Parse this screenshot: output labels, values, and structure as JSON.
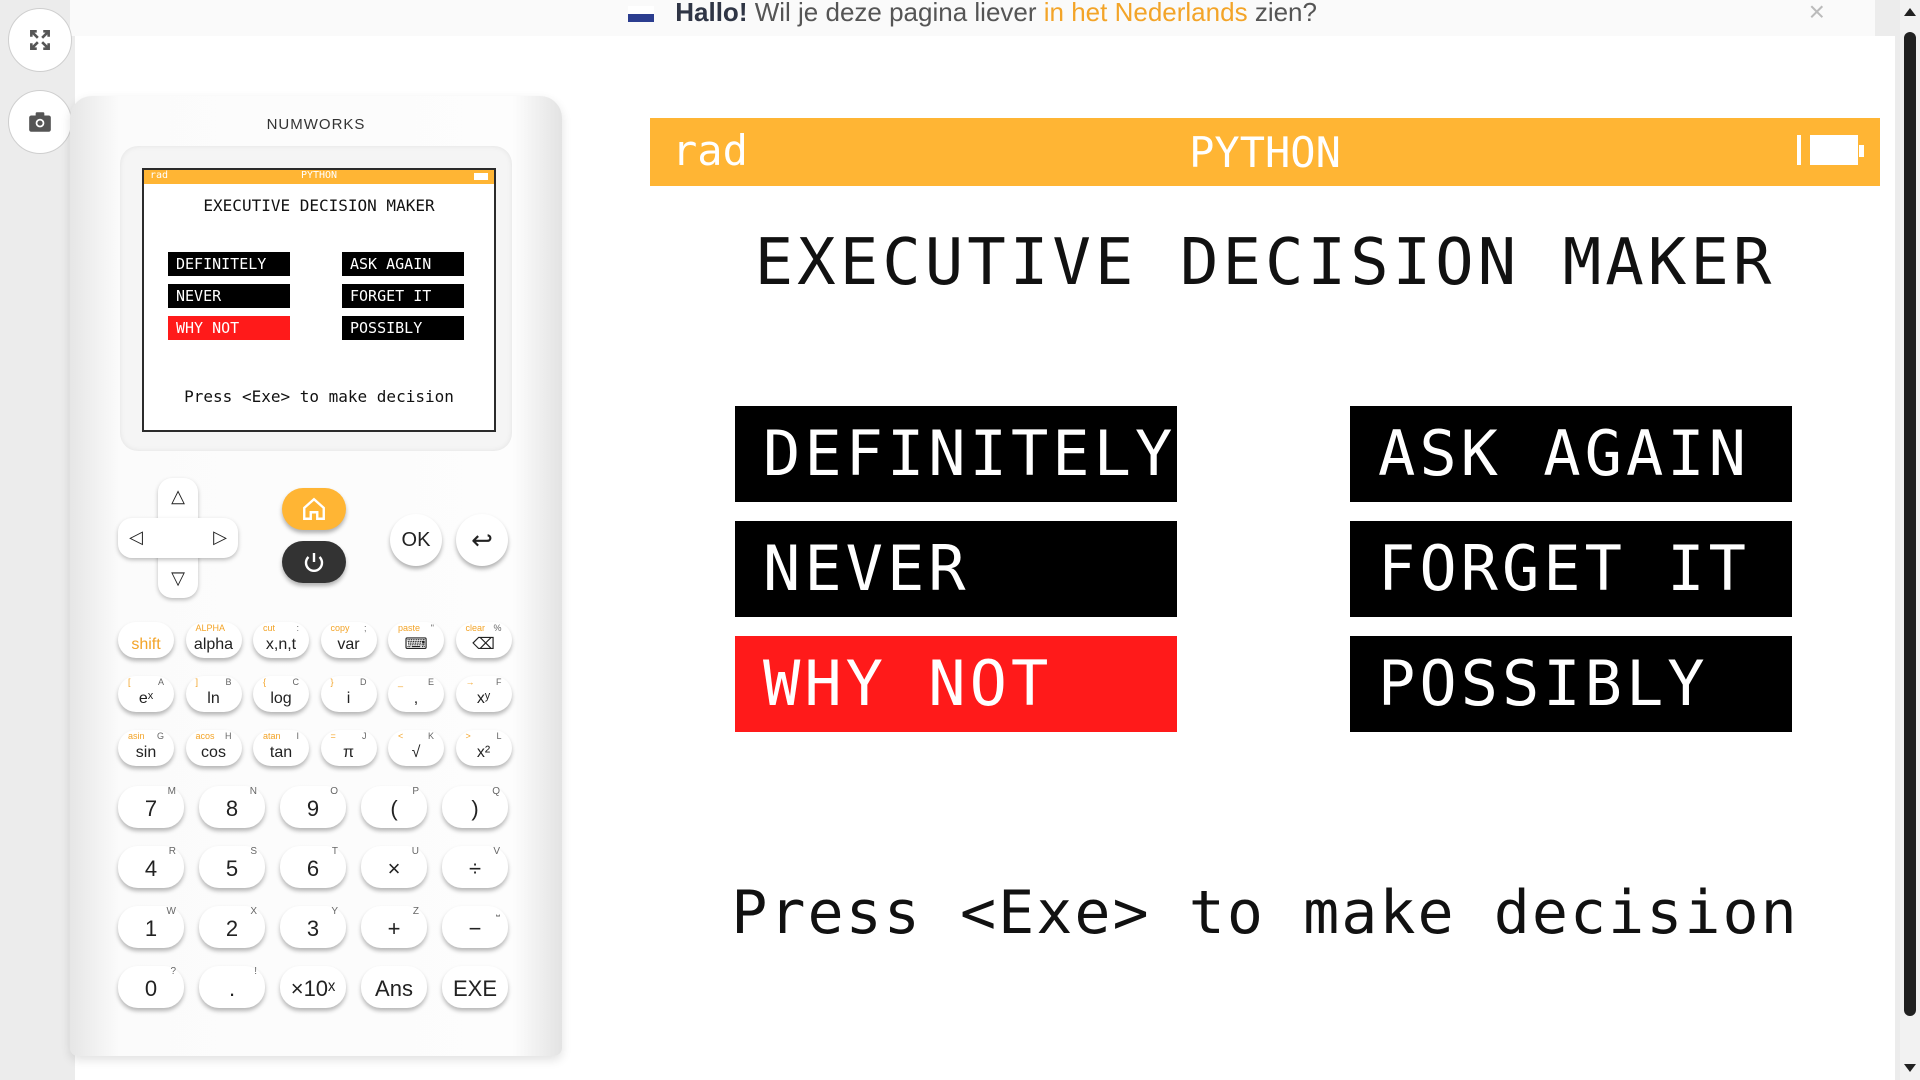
{
  "banner": {
    "hello": "Hallo!",
    "text": "Wil je deze pagina liever",
    "link": "in het Nederlands",
    "suffix": "zien?",
    "close_icon": "close-icon"
  },
  "sidebar": {
    "fullscreen_icon": "fullscreen-icon",
    "screenshot_icon": "camera-icon"
  },
  "calculator": {
    "brand": "NUMWORKS",
    "mini_screen": {
      "mode": "rad",
      "app": "PYTHON",
      "title": "EXECUTIVE DECISION MAKER",
      "options": [
        "DEFINITELY",
        "ASK AGAIN",
        "NEVER",
        "FORGET IT",
        "WHY NOT",
        "POSSIBLY"
      ],
      "selected": "WHY NOT",
      "prompt": "Press <Exe> to make decision"
    },
    "nav": {
      "up": "△",
      "down": "▽",
      "left": "◁",
      "right": "▷",
      "ok": "OK",
      "back": "↩",
      "home_icon": "home-icon",
      "power_icon": "power-icon"
    },
    "func_rows": [
      [
        {
          "main": "shift",
          "tl": "",
          "tr": ""
        },
        {
          "main": "alpha",
          "tl": "ALPHA",
          "tr": ""
        },
        {
          "main": "x,n,t",
          "tl": "cut",
          "tr": ":"
        },
        {
          "main": "var",
          "tl": "copy",
          "tr": ";"
        },
        {
          "main": "⌨",
          "tl": "paste",
          "tr": "\""
        },
        {
          "main": "⌫",
          "tl": "clear",
          "tr": "%"
        }
      ],
      [
        {
          "main": "eˣ",
          "tl": "[",
          "tr": "A"
        },
        {
          "main": "ln",
          "tl": "]",
          "tr": "B"
        },
        {
          "main": "log",
          "tl": "{",
          "tr": "C"
        },
        {
          "main": "i",
          "tl": "}",
          "tr": "D"
        },
        {
          "main": ",",
          "tl": "_",
          "tr": "E"
        },
        {
          "main": "xʸ",
          "tl": "→",
          "tr": "F"
        }
      ],
      [
        {
          "main": "sin",
          "tl": "asin",
          "tr": "G"
        },
        {
          "main": "cos",
          "tl": "acos",
          "tr": "H"
        },
        {
          "main": "tan",
          "tl": "atan",
          "tr": "I"
        },
        {
          "main": "π",
          "tl": "=",
          "tr": "J"
        },
        {
          "main": "√",
          "tl": "<",
          "tr": "K"
        },
        {
          "main": "x²",
          "tl": ">",
          "tr": "L"
        }
      ]
    ],
    "num_rows": [
      [
        {
          "main": "7",
          "tr": "M"
        },
        {
          "main": "8",
          "tr": "N"
        },
        {
          "main": "9",
          "tr": "O"
        },
        {
          "main": "(",
          "tr": "P"
        },
        {
          "main": ")",
          "tr": "Q"
        }
      ],
      [
        {
          "main": "4",
          "tr": "R"
        },
        {
          "main": "5",
          "tr": "S"
        },
        {
          "main": "6",
          "tr": "T"
        },
        {
          "main": "×",
          "tr": "U"
        },
        {
          "main": "÷",
          "tr": "V"
        }
      ],
      [
        {
          "main": "1",
          "tr": "W"
        },
        {
          "main": "2",
          "tr": "X"
        },
        {
          "main": "3",
          "tr": "Y"
        },
        {
          "main": "+",
          "tr": "Z"
        },
        {
          "main": "−",
          "tr": "⎵"
        }
      ],
      [
        {
          "main": "0",
          "tr": "?"
        },
        {
          "main": ".",
          "tr": "!"
        },
        {
          "main": "×10ˣ",
          "tr": ""
        },
        {
          "main": "Ans",
          "tr": ""
        },
        {
          "main": "EXE",
          "tr": ""
        }
      ]
    ]
  },
  "screen": {
    "mode": "rad",
    "app": "PYTHON",
    "title": "EXECUTIVE DECISION MAKER",
    "options": [
      "DEFINITELY",
      "ASK AGAIN",
      "NEVER",
      "FORGET IT",
      "WHY NOT",
      "POSSIBLY"
    ],
    "selected": "WHY NOT",
    "prompt": "Press <Exe> to make decision"
  },
  "colors": {
    "accent": "#ffb534",
    "selected": "#ff1a1a",
    "option_bg": "#000000",
    "link": "#f3a428"
  }
}
